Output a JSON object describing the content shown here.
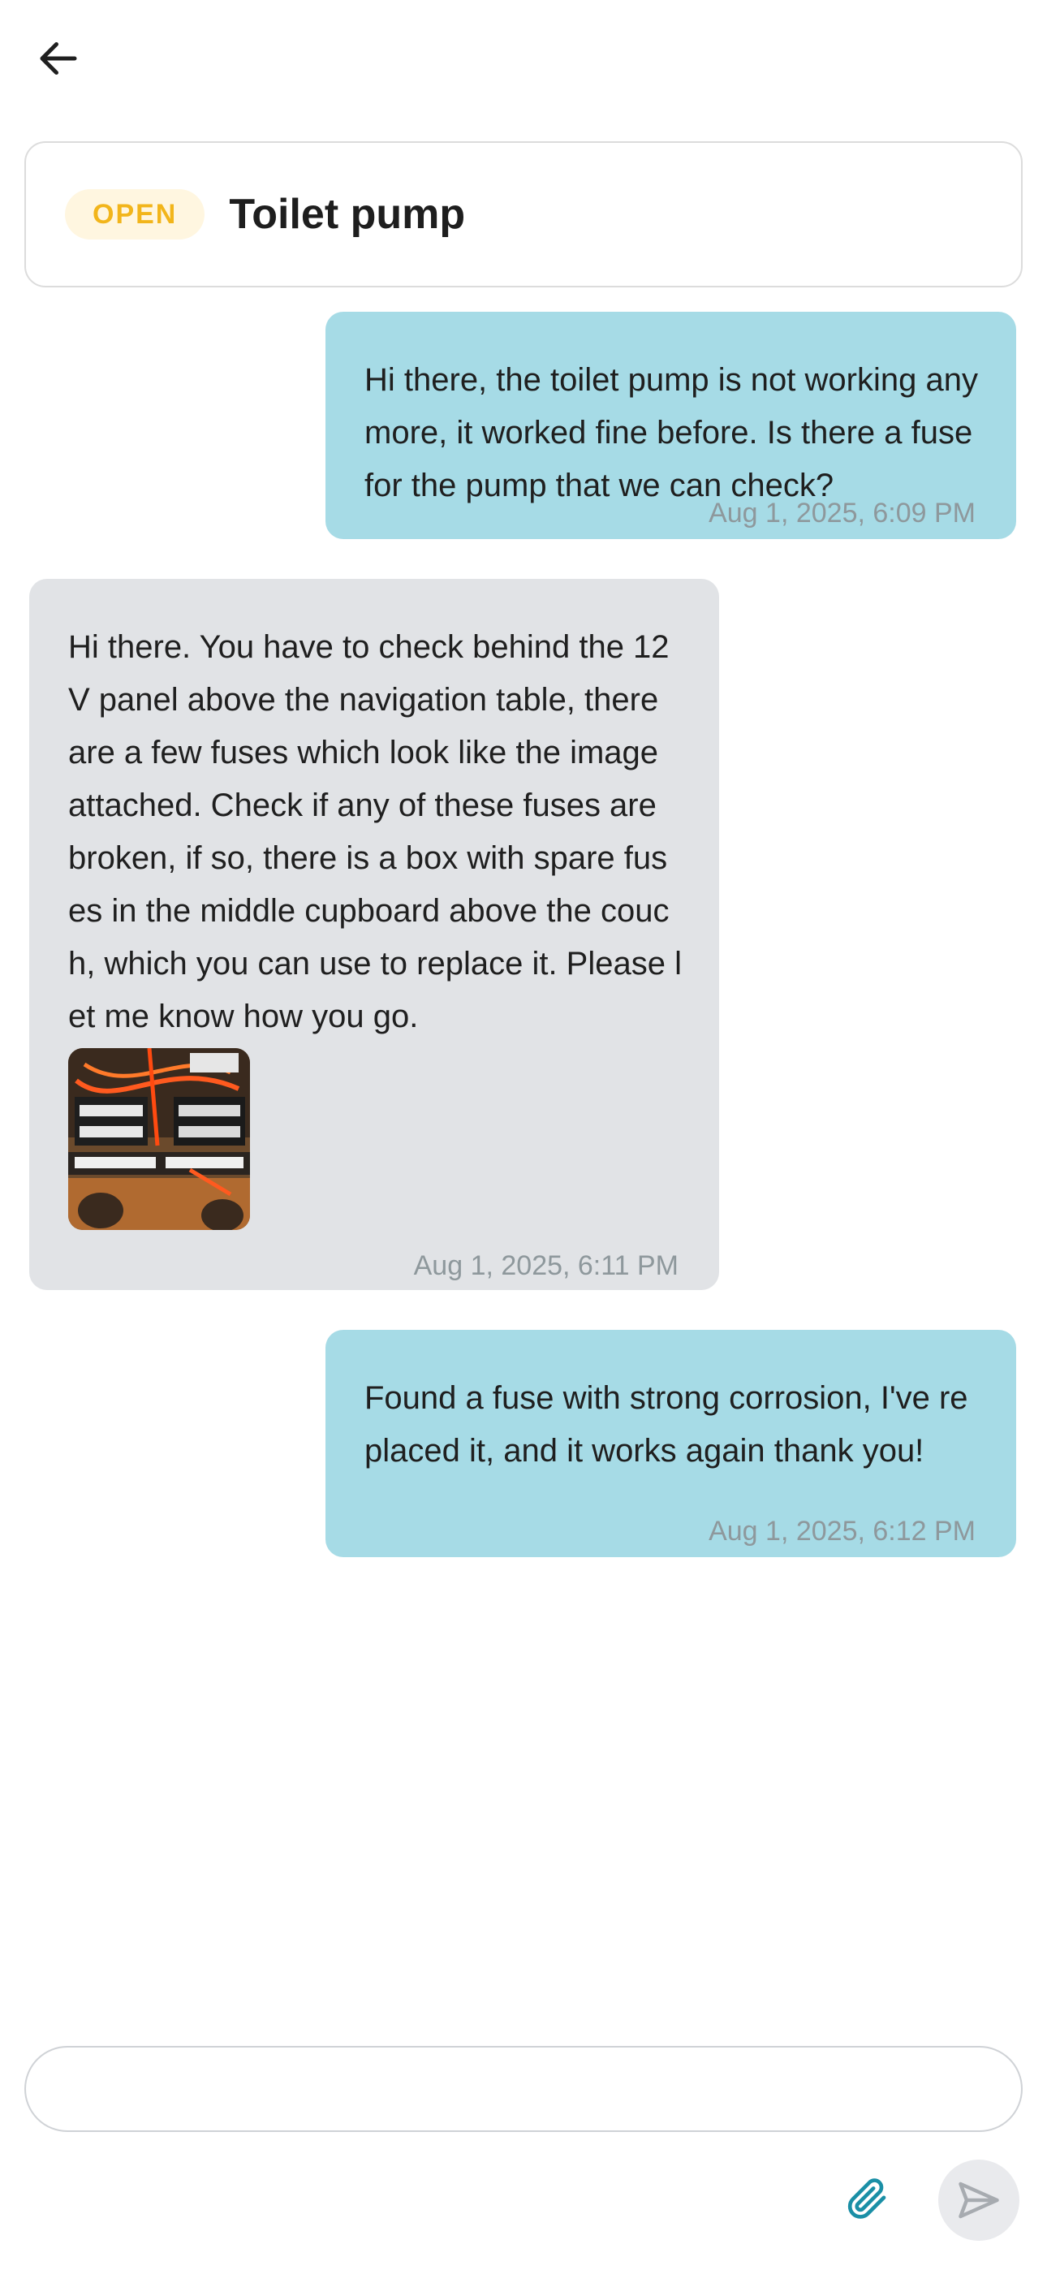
{
  "header": {
    "back_icon": "arrow-left-icon"
  },
  "ticket": {
    "status": "OPEN",
    "title": "Toilet pump",
    "status_color": "#f2b51b"
  },
  "messages": [
    {
      "direction": "outgoing",
      "text": "Hi there, the toilet pump is not working anymore, it worked fine before. Is there a fuse for the pump that we can check?",
      "time": "Aug 1, 2025, 6:09 PM"
    },
    {
      "direction": "incoming",
      "text": "Hi there. You have to check behind the 12V panel above the navigation table, there are a few fuses which look like the image attached. Check if any of these fuses are broken, if so, there is a box with spare fuses in the middle cupboard above the couch, which you can use to replace it. Please let me know how you go.",
      "time": "Aug 1, 2025, 6:11 PM",
      "attachment": "fuse-panel-photo"
    },
    {
      "direction": "outgoing",
      "text": "Found a fuse with strong corrosion, I've replaced it, and it works again thank you!",
      "time": "Aug 1, 2025, 6:12 PM"
    }
  ],
  "composer": {
    "value": "",
    "placeholder": "",
    "attach_icon": "paperclip-icon",
    "send_icon": "send-icon"
  },
  "colors": {
    "outgoing_bubble": "#a6dbe6",
    "incoming_bubble": "#e1e3e6",
    "accent": "#1a8fa6"
  }
}
